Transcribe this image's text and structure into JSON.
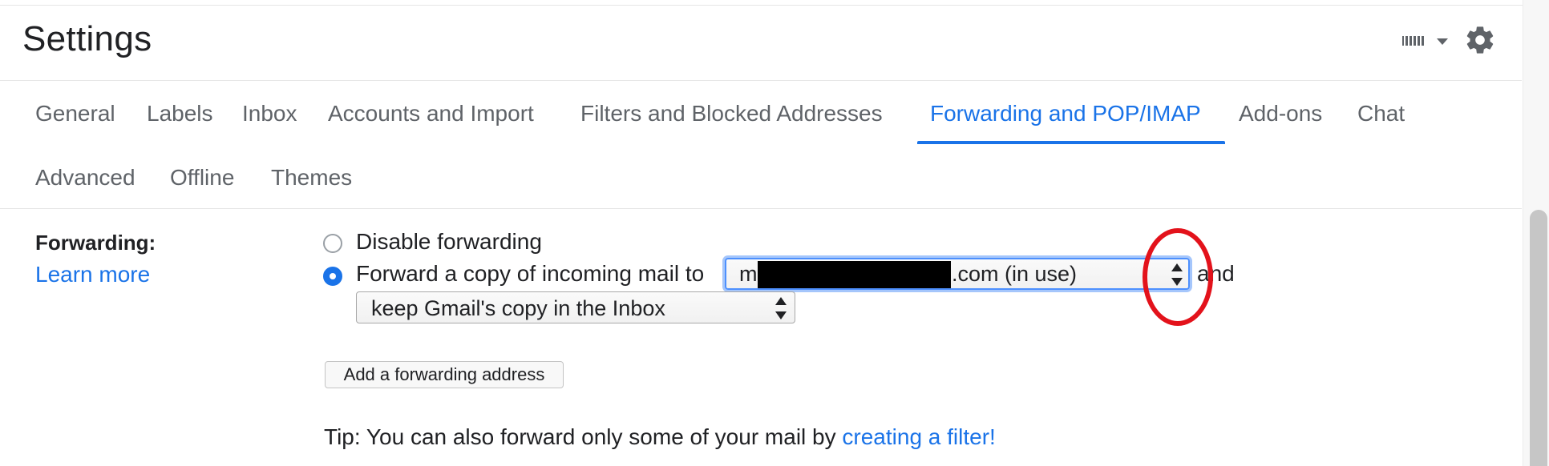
{
  "header": {
    "title": "Settings",
    "keyboard_icon": "keyboard-icon",
    "settings_icon": "gear-icon"
  },
  "tabs": [
    {
      "label": "General"
    },
    {
      "label": "Labels"
    },
    {
      "label": "Inbox"
    },
    {
      "label": "Accounts and Import"
    },
    {
      "label": "Filters and Blocked Addresses"
    },
    {
      "label": "Forwarding and POP/IMAP",
      "active": true
    },
    {
      "label": "Add-ons"
    },
    {
      "label": "Chat"
    },
    {
      "label": "Advanced"
    },
    {
      "label": "Offline"
    },
    {
      "label": "Themes"
    }
  ],
  "forwarding": {
    "label": "Forwarding:",
    "learn_more": "Learn more",
    "option_disable": "Disable forwarding",
    "option_forward": "Forward a copy of incoming mail to",
    "address_prefix": "m",
    "address_suffix": ".com (in use)",
    "and_text": "and",
    "action_select": "keep Gmail's copy in the Inbox",
    "add_button": "Add a forwarding address",
    "tip_text": "Tip: You can also forward only some of your mail by ",
    "tip_link": "creating a filter!"
  },
  "colors": {
    "accent": "#1a73e8",
    "annotation": "#e3121b",
    "text": "#202124",
    "muted": "#5f6368"
  }
}
